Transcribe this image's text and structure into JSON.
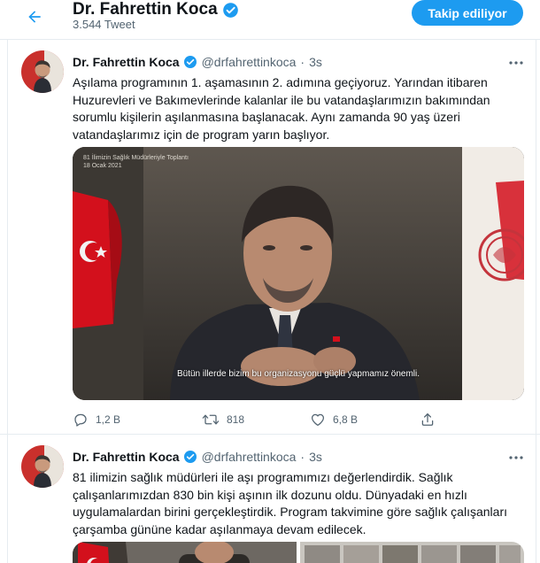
{
  "header": {
    "name": "Dr. Fahrettin Koca",
    "tweet_count": "3.544 Tweet",
    "follow_label": "Takip ediliyor"
  },
  "tweets": [
    {
      "name": "Dr. Fahrettin Koca",
      "handle": "@drfahrettinkoca",
      "separator": "·",
      "time": "3s",
      "text": "Aşılama programının 1. aşamasının 2. adımına geçiyoruz. Yarından itibaren Huzurevleri ve Bakımevlerinde kalanlar ile bu vatandaşlarımızın bakımından sorumlu kişilerin aşılanmasına başlanacak. Aynı zamanda 90 yaş üzeri vatandaşlarımız için de program yarın başlıyor.",
      "media": {
        "overlay_line1": "81 İlimizin Sağlık Müdürleriyle Toplantı",
        "overlay_line2": "18 Ocak 2021",
        "subtitle": "Bütün illerde bizim bu organizasyonu güçlü yapmamız önemli."
      },
      "actions": {
        "replies": "1,2 B",
        "retweets": "818",
        "likes": "6,8 B"
      }
    },
    {
      "name": "Dr. Fahrettin Koca",
      "handle": "@drfahrettinkoca",
      "separator": "·",
      "time": "3s",
      "text": "81 ilimizin sağlık müdürleri ile aşı programımızı değerlendirdik. Sağlık çalışanlarımızdan 830 bin kişi aşının ilk dozunu oldu. Dünyadaki en hızlı uygulamalardan birini gerçekleştirdik. Program takvimine göre sağlık çalışanları çarşamba gününe kadar aşılanmaya devam edilecek."
    }
  ],
  "colors": {
    "accent": "#1d9bf0",
    "text": "#0f1419",
    "secondary": "#536471",
    "flag_red": "#e30a17"
  }
}
